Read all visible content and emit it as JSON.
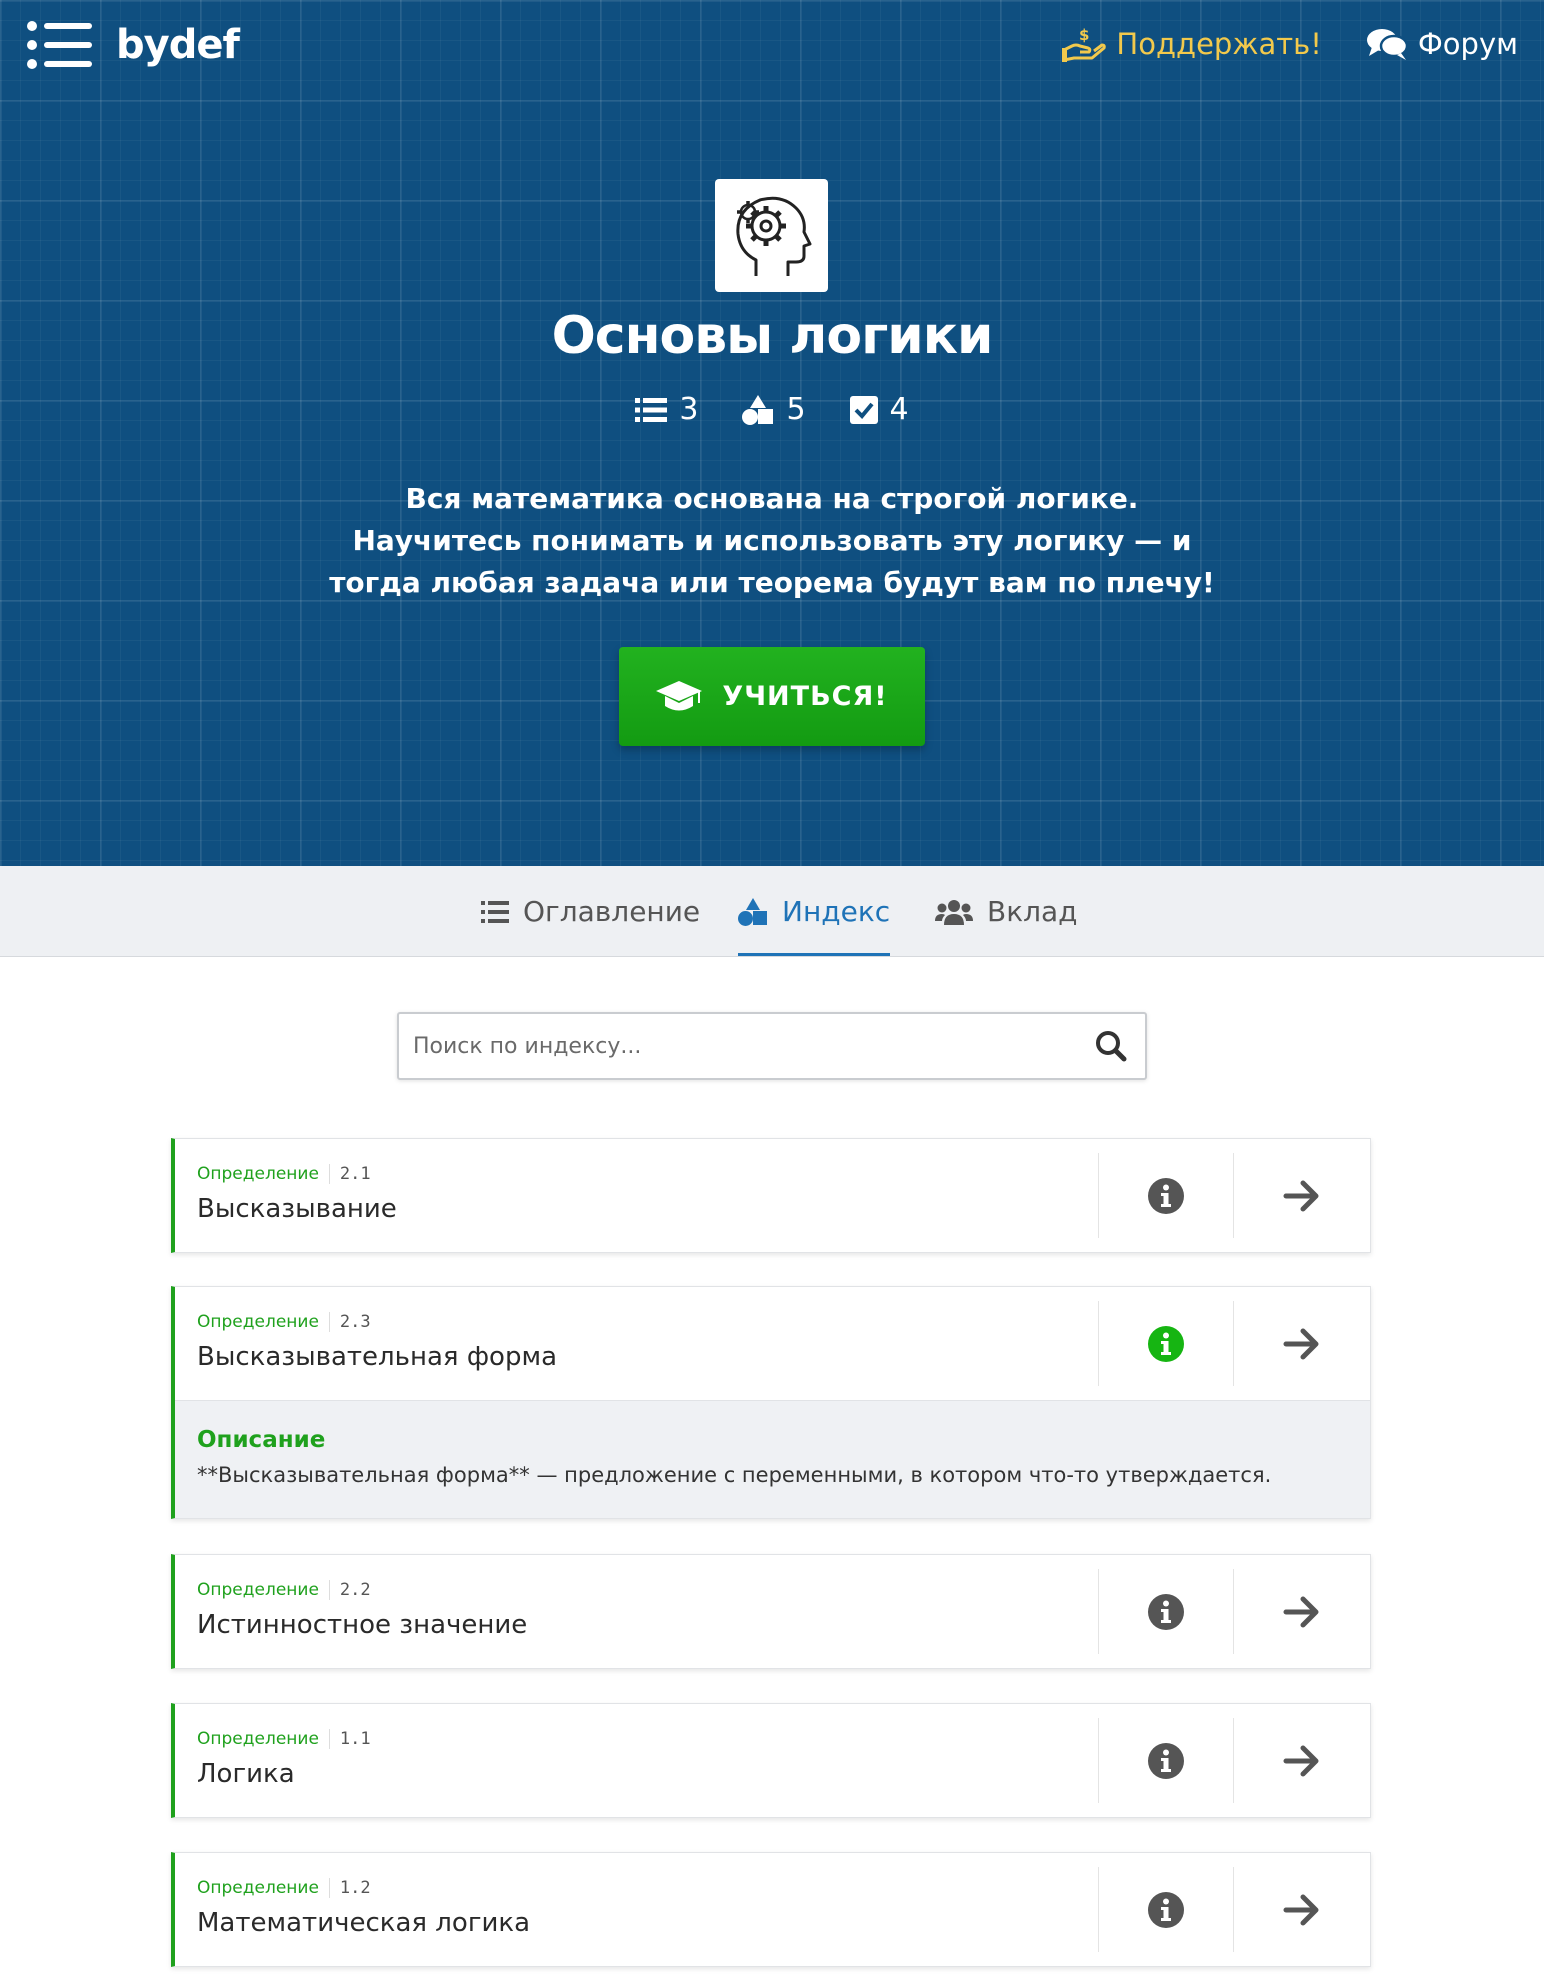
{
  "header": {
    "logo_text": "bydef",
    "support_label": "Поддержать!",
    "forum_label": "Форум"
  },
  "course": {
    "title": "Основы логики",
    "stats": {
      "chapters": "3",
      "definitions": "5",
      "exercises": "4"
    },
    "tagline": "Вся математика основана на строгой логике. Научитесь понимать и использовать эту логику — и тогда любая задача или теорема будут вам по плечу!",
    "learn_button": "УЧИТЬСЯ!"
  },
  "tabs": [
    {
      "label": "Оглавление",
      "icon": "list-icon"
    },
    {
      "label": "Индекс",
      "icon": "shapes-icon"
    },
    {
      "label": "Вклад",
      "icon": "users-icon"
    }
  ],
  "active_tab": "Индекс",
  "search": {
    "placeholder": "Поиск по индексу...",
    "value": ""
  },
  "entries": [
    {
      "type": "Определение",
      "number": "2.1",
      "title": "Высказывание",
      "expanded": false
    },
    {
      "type": "Определение",
      "number": "2.3",
      "title": "Высказывательная форма",
      "expanded": true,
      "description_title": "Описание",
      "description": "**Высказывательная форма** — предложение с переменными, в котором что-то утверждается."
    },
    {
      "type": "Определение",
      "number": "2.2",
      "title": "Истинностное значение",
      "expanded": false
    },
    {
      "type": "Определение",
      "number": "1.1",
      "title": "Логика",
      "expanded": false
    },
    {
      "type": "Определение",
      "number": "1.2",
      "title": "Математическая логика",
      "expanded": false
    }
  ],
  "colors": {
    "hero_bg": "#0f4f80",
    "accent_green": "#1fa11d",
    "active_blue": "#1f73b7",
    "support_yellow": "#f2c94c"
  }
}
